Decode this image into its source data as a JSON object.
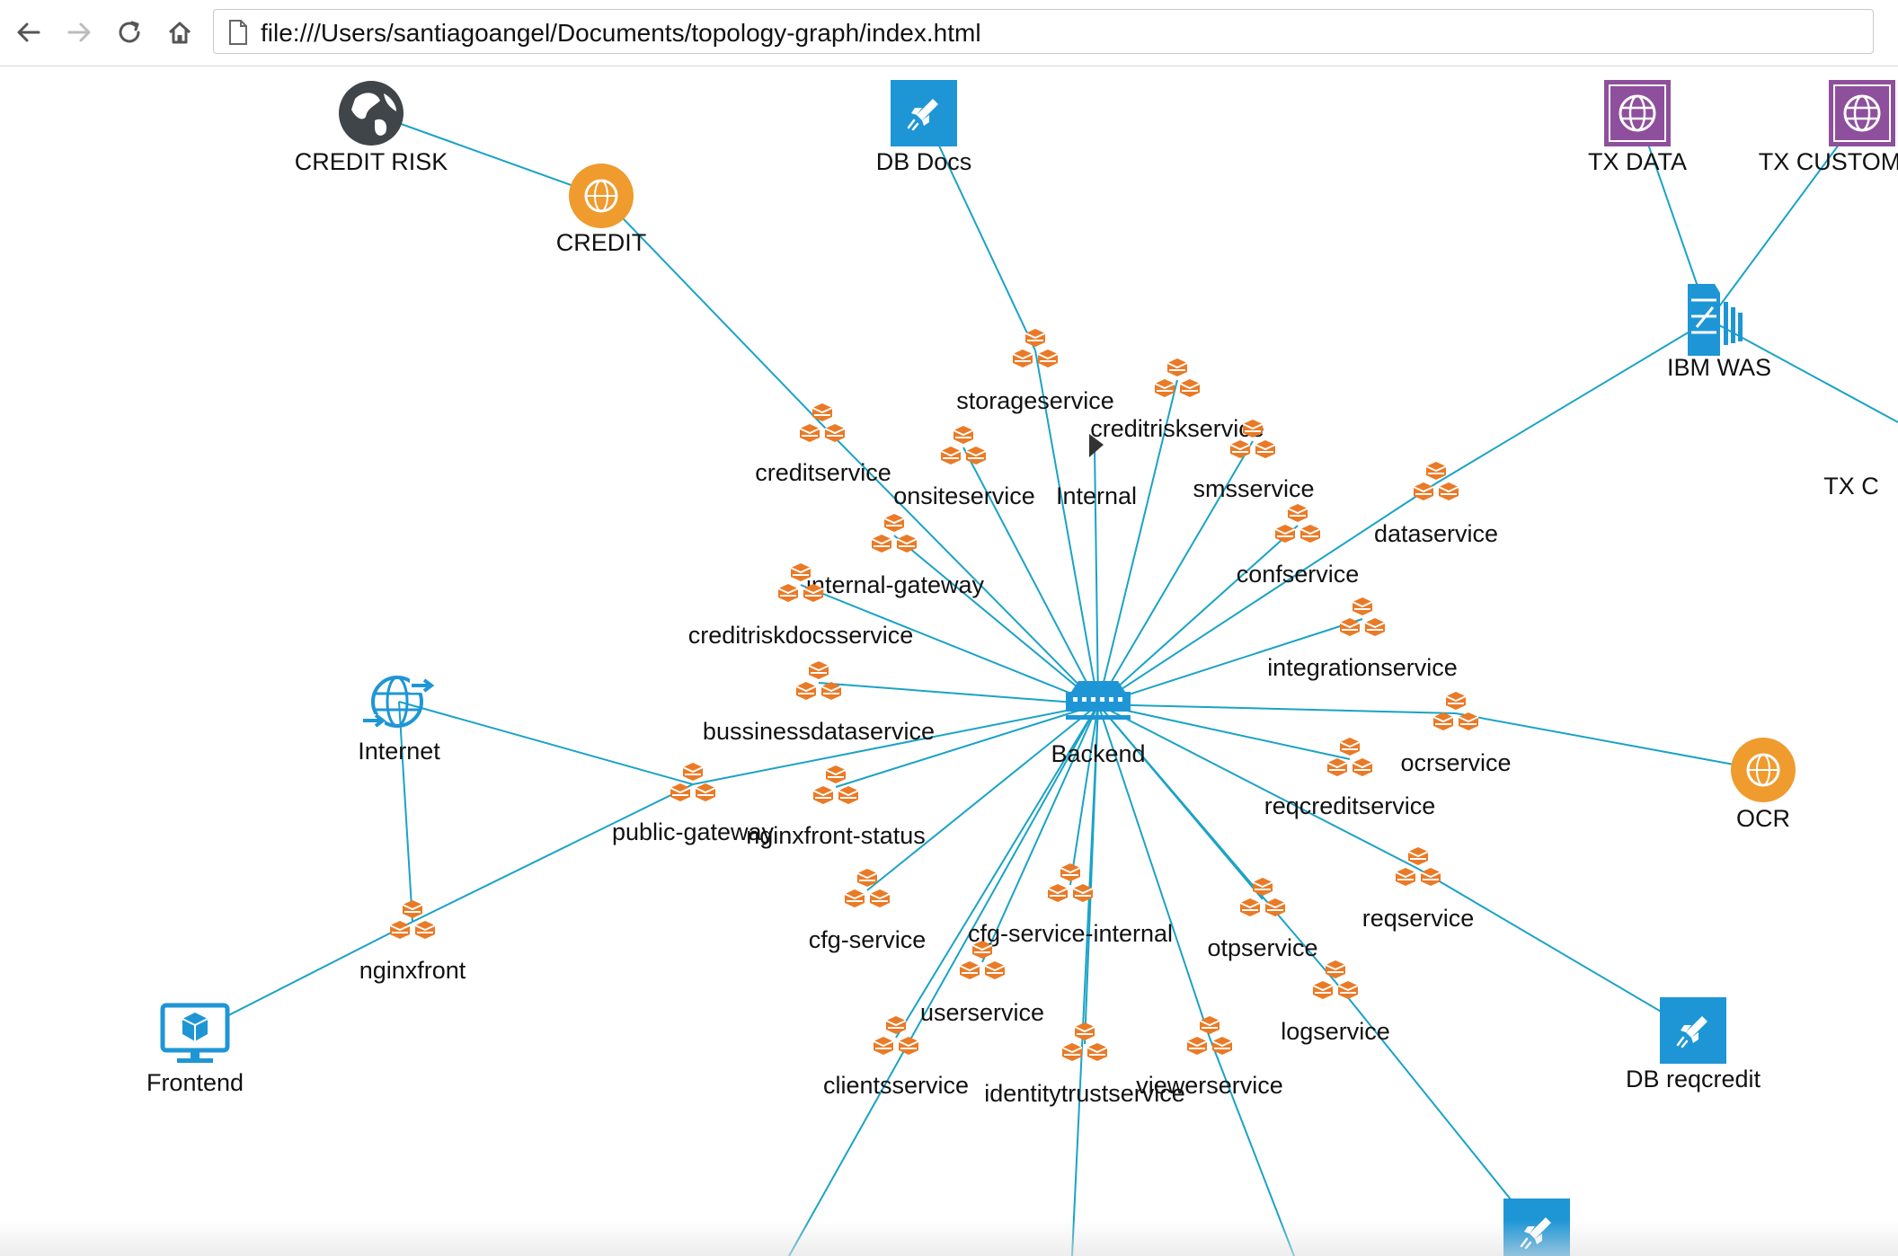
{
  "browser": {
    "url": "file:///Users/santiagoangel/Documents/topology-graph/index.html"
  },
  "colors": {
    "edge": "#1aa3c6",
    "service": "#ea7a26",
    "web": "#ef9b2e",
    "db": "#1e96d6",
    "tx": "#8e4f9c",
    "globe": "#3f4549",
    "network": "#1e96d6"
  },
  "graph": {
    "nodes": [
      {
        "id": "credit-risk",
        "label": "CREDIT RISK",
        "icon": "globe-icon"
      },
      {
        "id": "credit",
        "label": "CREDIT",
        "icon": "web-icon"
      },
      {
        "id": "db-docs",
        "label": "DB Docs",
        "icon": "database-rocket-icon"
      },
      {
        "id": "tx-data",
        "label": "TX DATA",
        "icon": "tx-globe-icon"
      },
      {
        "id": "tx-custom",
        "label": "TX CUSTOM",
        "icon": "tx-globe-icon"
      },
      {
        "id": "ibm-was",
        "label": "IBM WAS",
        "icon": "server-icon"
      },
      {
        "id": "tx-c",
        "label": "TX C",
        "icon": "none"
      },
      {
        "id": "storageservice",
        "label": "storageservice",
        "icon": "service-icon"
      },
      {
        "id": "creditriskservice",
        "label": "creditriskservice",
        "icon": "service-icon"
      },
      {
        "id": "creditservice",
        "label": "creditservice",
        "icon": "service-icon"
      },
      {
        "id": "onsiteservice",
        "label": "onsiteservice",
        "icon": "service-icon"
      },
      {
        "id": "internal",
        "label": "Internal",
        "icon": "flag-icon"
      },
      {
        "id": "smsservice",
        "label": "smsservice",
        "icon": "service-icon"
      },
      {
        "id": "dataservice",
        "label": "dataservice",
        "icon": "service-icon"
      },
      {
        "id": "internal-gateway",
        "label": "internal-gateway",
        "icon": "service-icon"
      },
      {
        "id": "confservice",
        "label": "confservice",
        "icon": "service-icon"
      },
      {
        "id": "creditriskdocsservice",
        "label": "creditriskdocsservice",
        "icon": "service-icon"
      },
      {
        "id": "integrationservice",
        "label": "integrationservice",
        "icon": "service-icon"
      },
      {
        "id": "internet",
        "label": "Internet",
        "icon": "internet-icon"
      },
      {
        "id": "bussinessdataservice",
        "label": "bussinessdataservice",
        "icon": "service-icon"
      },
      {
        "id": "backend",
        "label": "Backend",
        "icon": "router-icon"
      },
      {
        "id": "ocrservice",
        "label": "ocrservice",
        "icon": "service-icon"
      },
      {
        "id": "ocr",
        "label": "OCR",
        "icon": "web-icon"
      },
      {
        "id": "public-gateway",
        "label": "public-gateway",
        "icon": "service-icon"
      },
      {
        "id": "nginxfront-status",
        "label": "nginxfront-status",
        "icon": "service-icon"
      },
      {
        "id": "reqcreditservice",
        "label": "reqcreditservice",
        "icon": "service-icon"
      },
      {
        "id": "cfg-service",
        "label": "cfg-service",
        "icon": "service-icon"
      },
      {
        "id": "cfg-service-internal",
        "label": "cfg-service-internal",
        "icon": "service-icon"
      },
      {
        "id": "otpservice",
        "label": "otpservice",
        "icon": "service-icon"
      },
      {
        "id": "reqservice",
        "label": "reqservice",
        "icon": "service-icon"
      },
      {
        "id": "nginxfront",
        "label": "nginxfront",
        "icon": "service-icon"
      },
      {
        "id": "userservice",
        "label": "userservice",
        "icon": "service-icon"
      },
      {
        "id": "logservice",
        "label": "logservice",
        "icon": "service-icon"
      },
      {
        "id": "frontend",
        "label": "Frontend",
        "icon": "monitor-icon"
      },
      {
        "id": "clientsservice",
        "label": "clientsservice",
        "icon": "service-icon"
      },
      {
        "id": "identitytrustservice",
        "label": "identitytrustservice",
        "icon": "service-icon"
      },
      {
        "id": "viewerservice",
        "label": "viewerservice",
        "icon": "service-icon"
      },
      {
        "id": "db-reqcredit",
        "label": "DB reqcredit",
        "icon": "database-rocket-icon"
      },
      {
        "id": "db-bottom",
        "label": "",
        "icon": "database-rocket-icon"
      }
    ],
    "edges": [
      [
        "credit-risk",
        "credit"
      ],
      [
        "credit",
        "creditservice"
      ],
      [
        "db-docs",
        "storageservice"
      ],
      [
        "tx-data",
        "ibm-was"
      ],
      [
        "tx-custom",
        "ibm-was"
      ],
      [
        "ibm-was",
        "tx-c"
      ],
      [
        "ibm-was",
        "dataservice"
      ],
      [
        "creditservice",
        "backend"
      ],
      [
        "storageservice",
        "backend"
      ],
      [
        "onsiteservice",
        "backend"
      ],
      [
        "internal",
        "backend"
      ],
      [
        "creditriskservice",
        "backend"
      ],
      [
        "smsservice",
        "backend"
      ],
      [
        "dataservice",
        "backend"
      ],
      [
        "internal-gateway",
        "backend"
      ],
      [
        "confservice",
        "backend"
      ],
      [
        "creditriskdocsservice",
        "backend"
      ],
      [
        "integrationservice",
        "backend"
      ],
      [
        "bussinessdataservice",
        "backend"
      ],
      [
        "ocrservice",
        "backend"
      ],
      [
        "ocrservice",
        "ocr"
      ],
      [
        "public-gateway",
        "backend"
      ],
      [
        "public-gateway",
        "internet"
      ],
      [
        "public-gateway",
        "nginxfront"
      ],
      [
        "nginxfront-status",
        "backend"
      ],
      [
        "reqcreditservice",
        "backend"
      ],
      [
        "cfg-service",
        "backend"
      ],
      [
        "cfg-service-internal",
        "backend"
      ],
      [
        "otpservice",
        "backend"
      ],
      [
        "reqservice",
        "backend"
      ],
      [
        "reqservice",
        "db-reqcredit"
      ],
      [
        "logservice",
        "backend"
      ],
      [
        "logservice",
        "db-bottom"
      ],
      [
        "userservice",
        "backend"
      ],
      [
        "internet",
        "nginxfront"
      ],
      [
        "nginxfront",
        "frontend"
      ],
      [
        "clientsservice",
        "backend"
      ],
      [
        "identitytrustservice",
        "backend"
      ],
      [
        "viewerservice",
        "backend"
      ]
    ]
  }
}
